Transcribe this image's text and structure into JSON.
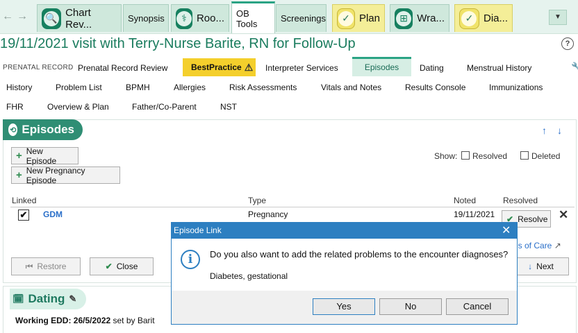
{
  "tabs": [
    {
      "label": "Chart Rev..."
    },
    {
      "label": "Synopsis"
    },
    {
      "label": "Roo..."
    },
    {
      "label": "OB Tools"
    },
    {
      "label": "Screenings"
    },
    {
      "label": "Plan"
    },
    {
      "label": "Wra..."
    },
    {
      "label": "Dia..."
    }
  ],
  "title": "19/11/2021 visit with Terry-Nurse Barite, RN for Follow-Up",
  "nav_row1": {
    "record_label": "PRENATAL RECORD",
    "items": [
      "Prenatal Record Review",
      "BestPractice",
      "Interpreter Services",
      "Episodes",
      "Dating",
      "Menstrual History"
    ]
  },
  "nav_row2": [
    "History",
    "Problem List",
    "BPMH",
    "Allergies",
    "Risk Assessments",
    "Vitals and Notes",
    "Results Console",
    "Immunizations"
  ],
  "nav_row3": [
    "FHR",
    "Overview & Plan",
    "Father/Co-Parent",
    "NST"
  ],
  "episodes": {
    "heading": "Episodes",
    "new_episode": "New Episode",
    "new_pregnancy_episode": "New Pregnancy Episode",
    "show_label": "Show:",
    "resolved_label": "Resolved",
    "deleted_label": "Deleted",
    "columns": {
      "linked": "Linked",
      "type": "Type",
      "noted": "Noted",
      "resolved": "Resolved"
    },
    "row": {
      "name": "GDM",
      "type": "Pregnancy",
      "noted": "19/11/2021",
      "resolve_btn": "Resolve"
    },
    "care_link": "es of Care",
    "restore": "Restore",
    "close": "Close",
    "next": "Next"
  },
  "dating": {
    "heading": "Dating",
    "edd_bold": "Working EDD: 26/5/2022",
    "edd_rest": " set by Barit"
  },
  "dialog": {
    "title": "Episode Link",
    "question": "Do you also want to add the related problems to the encounter diagnoses?",
    "detail": "Diabetes, gestational",
    "yes": "Yes",
    "no": "No",
    "cancel": "Cancel"
  },
  "colors": {
    "accent": "#2f8e74",
    "dialog_blue": "#2d7fc1",
    "bestpractice": "#f4cf2c"
  }
}
